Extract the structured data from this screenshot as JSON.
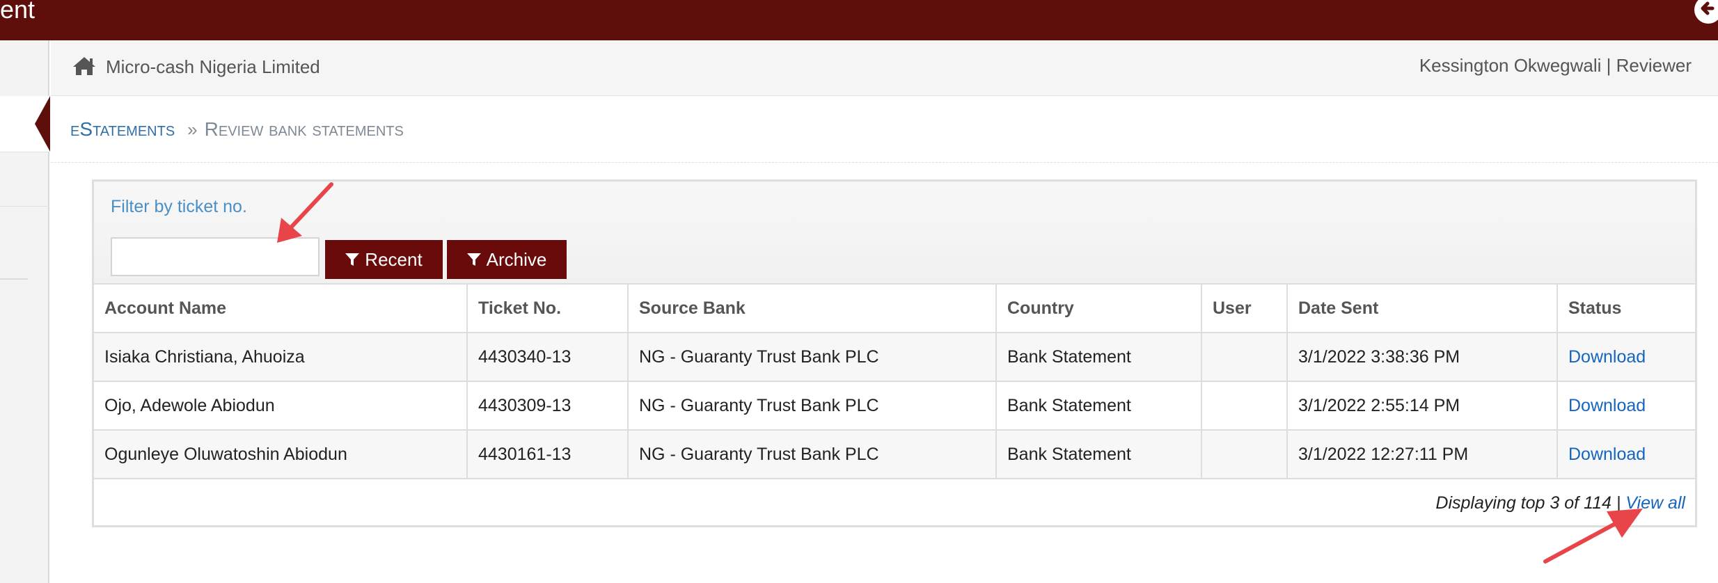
{
  "topbar": {
    "title": "ent"
  },
  "header": {
    "company": "Micro-cash Nigeria Limited",
    "user": "Kessington Okwegwali | Reviewer"
  },
  "breadcrumb": {
    "root": "eStatements",
    "separator": "»",
    "current": "Review bank statements"
  },
  "filter": {
    "label": "Filter by ticket no.",
    "input_value": "",
    "recent_label": "Recent",
    "archive_label": "Archive"
  },
  "table": {
    "columns": [
      "Account Name",
      "Ticket No.",
      "Source Bank",
      "Country",
      "User",
      "Date Sent",
      "Status"
    ],
    "rows": [
      {
        "account_name": "Isiaka Christiana, Ahuoiza",
        "ticket_no": "4430340-13",
        "source_bank": "NG - Guaranty Trust Bank PLC",
        "country": "Bank Statement",
        "user": "",
        "date_sent": "3/1/2022 3:38:36 PM",
        "status": "Download"
      },
      {
        "account_name": "Ojo, Adewole Abiodun",
        "ticket_no": "4430309-13",
        "source_bank": "NG - Guaranty Trust Bank PLC",
        "country": "Bank Statement",
        "user": "",
        "date_sent": "3/1/2022 2:55:14 PM",
        "status": "Download"
      },
      {
        "account_name": "Ogunleye Oluwatoshin Abiodun",
        "ticket_no": "4430161-13",
        "source_bank": "NG - Guaranty Trust Bank PLC",
        "country": "Bank Statement",
        "user": "",
        "date_sent": "3/1/2022 12:27:11 PM",
        "status": "Download"
      }
    ]
  },
  "footer": {
    "summary": "Displaying top 3 of 114 |",
    "view_all": "View all"
  },
  "colors": {
    "brand": "#5e0f0b",
    "button": "#6a0b0b",
    "link": "#1565c0",
    "annotation_arrow": "#e8454a"
  },
  "icons": [
    "back-arrow-icon",
    "home-icon",
    "filter-icon"
  ]
}
